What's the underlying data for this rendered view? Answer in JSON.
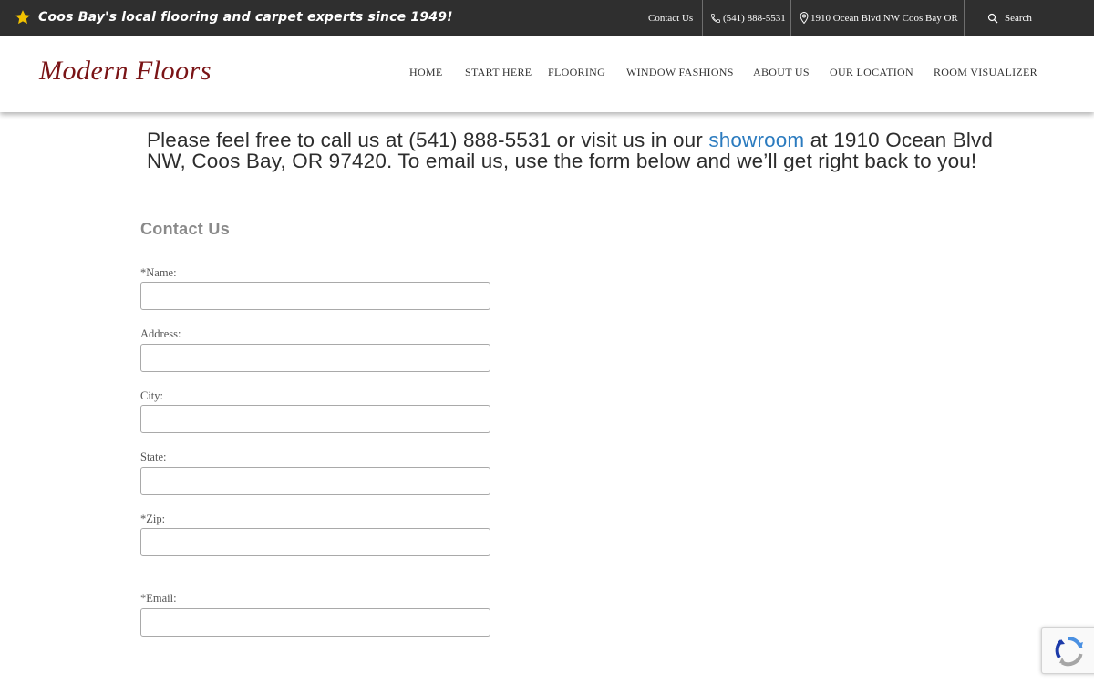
{
  "topbar": {
    "tagline": "Coos Bay's local flooring and carpet experts since 1949!",
    "contact_label": "Contact Us",
    "phone_label": "(541) 888-5531",
    "address_label": "1910 Ocean Blvd NW Coos Bay OR",
    "search_label": "Search"
  },
  "header": {
    "logo_text": "Modern Floors",
    "nav": {
      "home": "HOME",
      "start": "START HERE",
      "flooring": "FLOORING",
      "window": "WINDOW FASHIONS",
      "about": "ABOUT US",
      "location": "OUR LOCATION",
      "visualizer": "ROOM VISUALIZER"
    }
  },
  "intro": {
    "part1": "Please feel free to call us at (541) 888-5531 or visit us in our ",
    "link": "showroom",
    "part2": " at 1910 Ocean Blvd NW, Coos Bay, OR 97420. To email us, use the form below and we’ll get right back to you!"
  },
  "form": {
    "title": "Contact Us",
    "name_label": "*Name:",
    "address_label": "Address:",
    "city_label": "City:",
    "state_label": "State:",
    "zip_label": "*Zip:",
    "email_label": "*Email:",
    "name_value": "",
    "address_value": "",
    "city_value": "",
    "state_value": "",
    "zip_value": "",
    "email_value": ""
  },
  "icons": {
    "star": "star-icon",
    "phone": "phone-icon",
    "map_pin": "map-pin-icon",
    "search": "search-icon",
    "recaptcha": "recaptcha-icon"
  },
  "colors": {
    "topbar_bg": "#2f2f2f",
    "star": "#f2c200",
    "logo": "#7a1416",
    "link": "#2b7bbf",
    "form_title": "#8a8a8a"
  }
}
